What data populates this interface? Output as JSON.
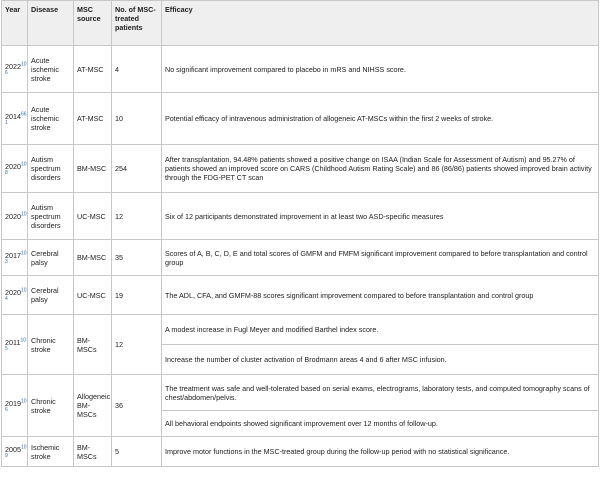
{
  "headers": {
    "year": "Year",
    "disease": "Disease",
    "source": "MSC source",
    "count": "No. of MSC-treated patients",
    "efficacy": "Efficacy"
  },
  "rows": [
    {
      "year": "2022",
      "ref": "10",
      "ref2": "6",
      "disease": "Acute ischemic stroke",
      "source": "AT-MSC",
      "count": "4",
      "efficacy": "No significant improvement compared to placebo in mRS and NIHSS score."
    },
    {
      "year": "2014",
      "ref": "66",
      "ref2": "1",
      "disease": "Acute ischemic stroke",
      "source": "AT-MSC",
      "count": "10",
      "efficacy": "Potential efficacy of intravenous administration of allogeneic AT-MSCs within the first 2 weeks of stroke."
    },
    {
      "year": "2020",
      "ref": "10",
      "ref2": "8",
      "disease": "Autism spectrum disorders",
      "source": "BM-MSC",
      "count": "254",
      "efficacy": "After transplantation, 94.48% patients showed a positive change on ISAA (Indian Scale for Assessment of Autism) and 95.27% of patients showed an improved score on CARS (Childhood Autism Rating Scale) and 86 (86/86) patients showed improved brain activity through the FDG-PET CT scan"
    },
    {
      "year": "2020",
      "ref": "10",
      "ref2": "",
      "disease": "Autism spectrum disorders",
      "source": "UC-MSC",
      "count": "12",
      "efficacy": "Six of 12 participants demonstrated improvement in at least two ASD-specific measures"
    },
    {
      "year": "2017",
      "ref": "10",
      "ref2": "3",
      "disease": "Cerebral palsy",
      "source": "BM-MSC",
      "count": "35",
      "efficacy": "Scores of A, B, C, D, E and total scores of GMFM and FMFM significant improvement compared to before transplantation and control group"
    },
    {
      "year": "2020",
      "ref": "10",
      "ref2": "4",
      "disease": "Cerebral palsy",
      "source": "UC-MSC",
      "count": "19",
      "efficacy": "The ADL, CFA, and GMFM-88 scores significant improvement compared to before transplantation and control group"
    },
    {
      "year": "2011",
      "ref": "10",
      "ref2": "5",
      "disease": "Chronic stroke",
      "source": "BM-MSCs",
      "count": "12",
      "efficacy": "A modest increase in Fugl Meyer and modified Barthel index score.",
      "efficacy2": "Increase the number of cluster activation of Brodmann areas 4 and 6 after MSC infusion."
    },
    {
      "year": "2019",
      "ref": "10",
      "ref2": "6",
      "disease": "Chronic stroke",
      "source": "Allogeneic BM-MSCs",
      "count": "36",
      "efficacy": "The treatment was safe and well-tolerated based on serial exams, electrograms, laboratory tests, and computed tomography scans of chest/abdomen/pelvis.",
      "efficacy2": "All behavioral endpoints showed significant improvement over 12 months of follow-up."
    },
    {
      "year": "2005",
      "ref": "10",
      "ref2": "9",
      "disease": "Ischemic stroke",
      "source": "BM-MSCs",
      "count": "5",
      "efficacy": "Improve motor functions in the MSC-treated group during the follow-up period with no statistical significance."
    }
  ]
}
